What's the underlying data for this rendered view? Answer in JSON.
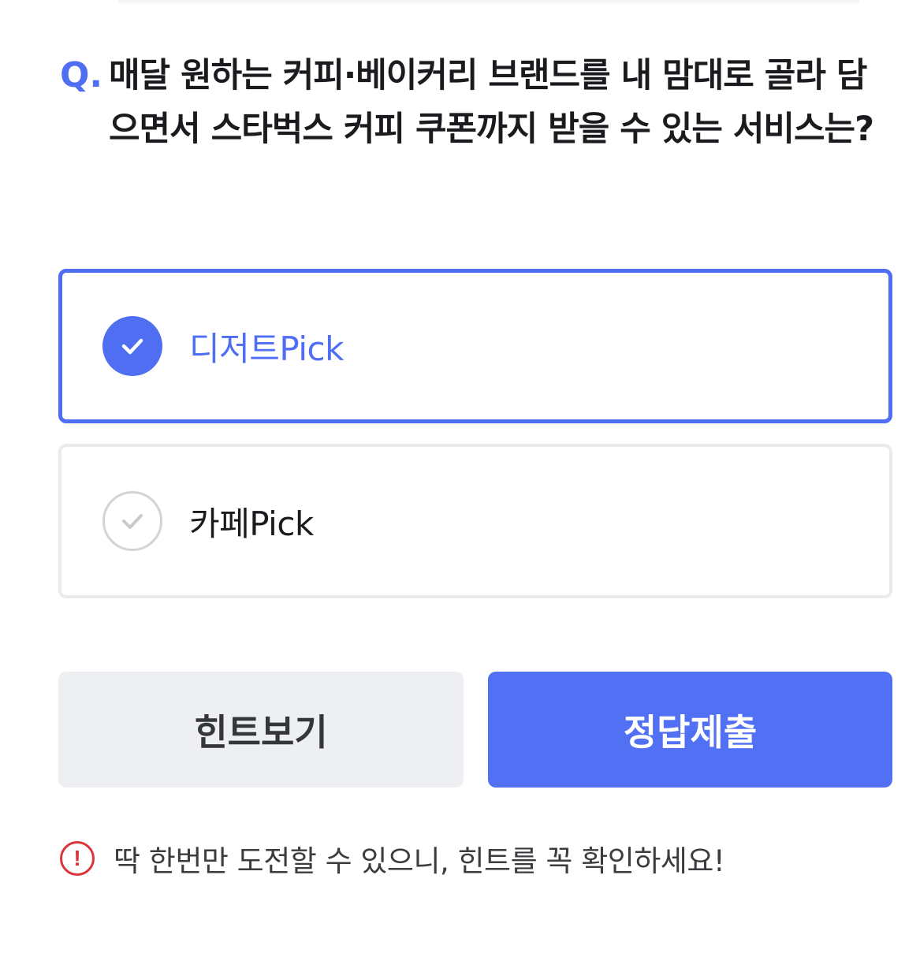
{
  "question": {
    "prefix": "Q.",
    "text": "매달 원하는 커피·베이커리 브랜드를 내 맘대로 골라 담으면서 스타벅스 커피 쿠폰까지 받을 수 있는 서비스는?"
  },
  "options": [
    {
      "label": "디저트Pick",
      "selected": true
    },
    {
      "label": "카페Pick",
      "selected": false
    }
  ],
  "buttons": {
    "hint_label": "힌트보기",
    "submit_label": "정답제출"
  },
  "notice": {
    "icon": "exclamation-circle-icon",
    "icon_glyph": "!",
    "text": "딱 한번만 도전할 수 있으니, 힌트를 꼭 확인하세요!"
  },
  "colors": {
    "accent": "#4f6ef2",
    "submit_bg": "#5170f3",
    "hint_bg": "#eeeff2",
    "warning": "#d9353a",
    "unselected_border": "#ebebee"
  }
}
